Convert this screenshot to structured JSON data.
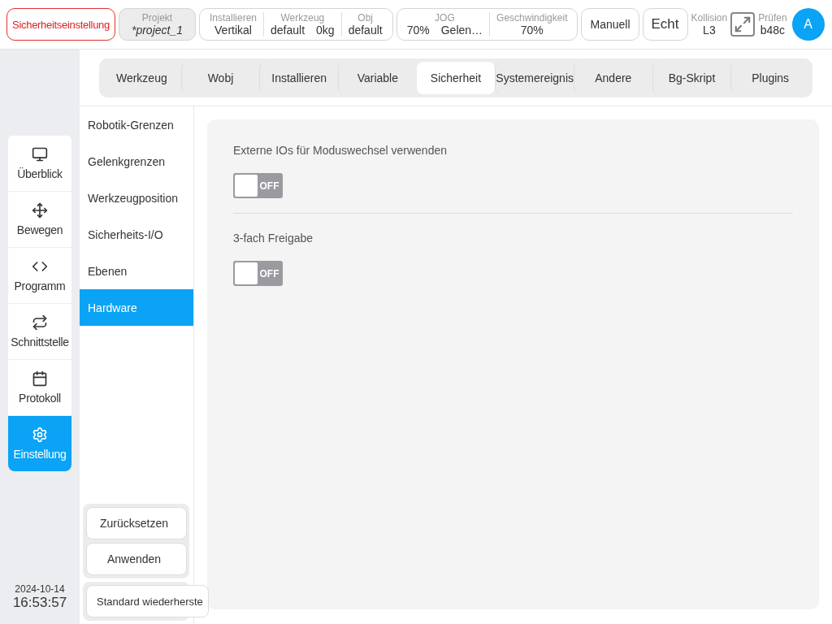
{
  "top_bar": {
    "alarm": "Sicherheitseinstellung",
    "project": {
      "label": "Projekt",
      "value": "*project_1"
    },
    "install_group": [
      {
        "label": "Installieren",
        "values": [
          "Vertikal"
        ]
      },
      {
        "label": "Werkzeug",
        "values": [
          "default",
          "0kg"
        ]
      },
      {
        "label": "Obj",
        "values": [
          "default"
        ]
      }
    ],
    "jog_group": [
      {
        "label": "JOG",
        "values": [
          "70%",
          "Gelen…"
        ]
      },
      {
        "label": "Geschwindigkeit",
        "values": [
          "70%"
        ]
      }
    ],
    "mode_buttons": [
      "Manuell",
      "Echt"
    ],
    "collision": {
      "label": "Kollision",
      "value": "L3"
    },
    "check": {
      "label": "Prüfen",
      "value": "b48c"
    },
    "avatar": "A"
  },
  "nav": [
    {
      "label": "Überblick",
      "kind": "monitor",
      "selected": false
    },
    {
      "label": "Bewegen",
      "kind": "move",
      "selected": false
    },
    {
      "label": "Programm",
      "kind": "code",
      "selected": false
    },
    {
      "label": "Schnittstelle",
      "kind": "repeat",
      "selected": false
    },
    {
      "label": "Protokoll",
      "kind": "calendar",
      "selected": false
    },
    {
      "label": "Einstellung",
      "kind": "settings",
      "selected": true
    }
  ],
  "datetime": {
    "date": "2024-10-14",
    "time": "16:53:57"
  },
  "tabs": [
    {
      "label": "Werkzeug",
      "selected": false
    },
    {
      "label": "Wobj",
      "selected": false
    },
    {
      "label": "Installieren",
      "selected": false
    },
    {
      "label": "Variable",
      "selected": false
    },
    {
      "label": "Sicherheit",
      "selected": true
    },
    {
      "label": "Systemereignis",
      "selected": false
    },
    {
      "label": "Andere",
      "selected": false
    },
    {
      "label": "Bg-Skript",
      "selected": false
    },
    {
      "label": "Plugins",
      "selected": false
    }
  ],
  "submenu": [
    {
      "label": "Robotik-Grenzen",
      "selected": false
    },
    {
      "label": "Gelenkgrenzen",
      "selected": false
    },
    {
      "label": "Werkzeugposition",
      "selected": false
    },
    {
      "label": "Sicherheits-I/O",
      "selected": false
    },
    {
      "label": "Ebenen",
      "selected": false
    },
    {
      "label": "Hardware",
      "selected": true
    }
  ],
  "action_buttons": [
    "Zurücksetzen",
    "Anwenden"
  ],
  "restore_button": "Standard wiederherste",
  "settings": [
    {
      "label": "Externe IOs für Moduswechsel verwenden",
      "on": false,
      "state_text": "OFF"
    },
    {
      "label": "3-fach Freigabe",
      "on": false,
      "state_text": "OFF"
    }
  ]
}
